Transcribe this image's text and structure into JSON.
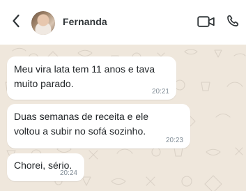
{
  "header": {
    "contact_name": "Fernanda",
    "icons": {
      "back": "chevron-left-icon",
      "video": "video-call-icon",
      "phone": "phone-call-icon"
    }
  },
  "messages": [
    {
      "text": "Meu vira lata tem 11 anos e tava\nmuito parado.",
      "time": "20:21"
    },
    {
      "text": "Duas semanas de receita e ele\nvoltou a subir no sofá sozinho.",
      "time": "20:23"
    },
    {
      "text": "Chorei, sério.",
      "time": "20:24"
    }
  ],
  "colors": {
    "chat_background": "#efe7dc",
    "bubble_background": "#ffffff",
    "text_primary": "#1f2326",
    "text_secondary": "#7f8b95"
  }
}
